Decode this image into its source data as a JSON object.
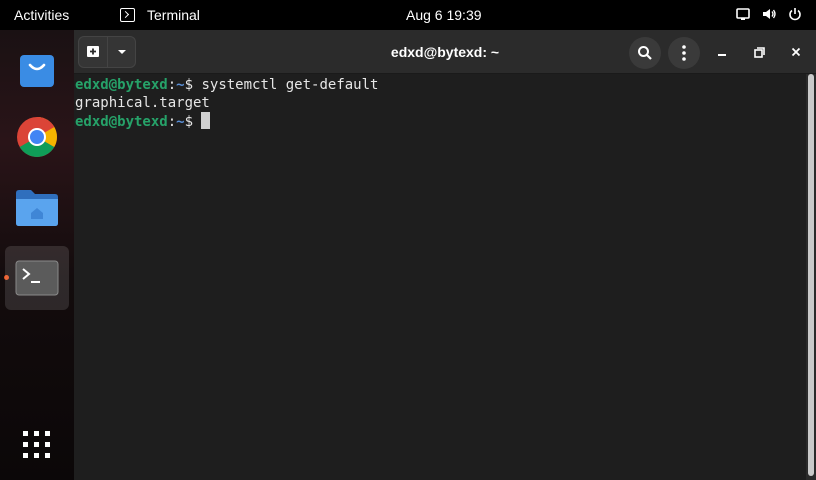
{
  "topbar": {
    "activities": "Activities",
    "app_name": "Terminal",
    "clock": "Aug 6  19:39",
    "icons": [
      "screen-icon",
      "volume-icon",
      "power-icon"
    ]
  },
  "dock": {
    "items": [
      {
        "name": "App Store",
        "icon": "store-icon"
      },
      {
        "name": "Chrome",
        "icon": "chrome-icon"
      },
      {
        "name": "Files",
        "icon": "files-icon"
      },
      {
        "name": "Terminal",
        "icon": "terminal-icon",
        "running": true
      },
      {
        "name": "Show Applications",
        "icon": "apps-grid-icon"
      }
    ],
    "running_indicator_color": "#e95420"
  },
  "window": {
    "title": "edxd@bytexd: ~",
    "buttons": [
      "new-tab",
      "tab-menu",
      "search",
      "menu",
      "minimize",
      "maximize",
      "close"
    ]
  },
  "terminal": {
    "lines": [
      {
        "user": "edxd@bytexd",
        "sep": ":",
        "path": "~",
        "symbol": "$",
        "command": " systemctl get-default"
      },
      {
        "output": "graphical.target"
      },
      {
        "user": "edxd@bytexd",
        "sep": ":",
        "path": "~",
        "symbol": "$",
        "command": " "
      }
    ]
  },
  "colors": {
    "prompt_user": "#26a269",
    "prompt_path": "#5a8fd6",
    "terminal_bg": "#1e1e1e",
    "headerbar_bg": "#2b2b2b"
  }
}
